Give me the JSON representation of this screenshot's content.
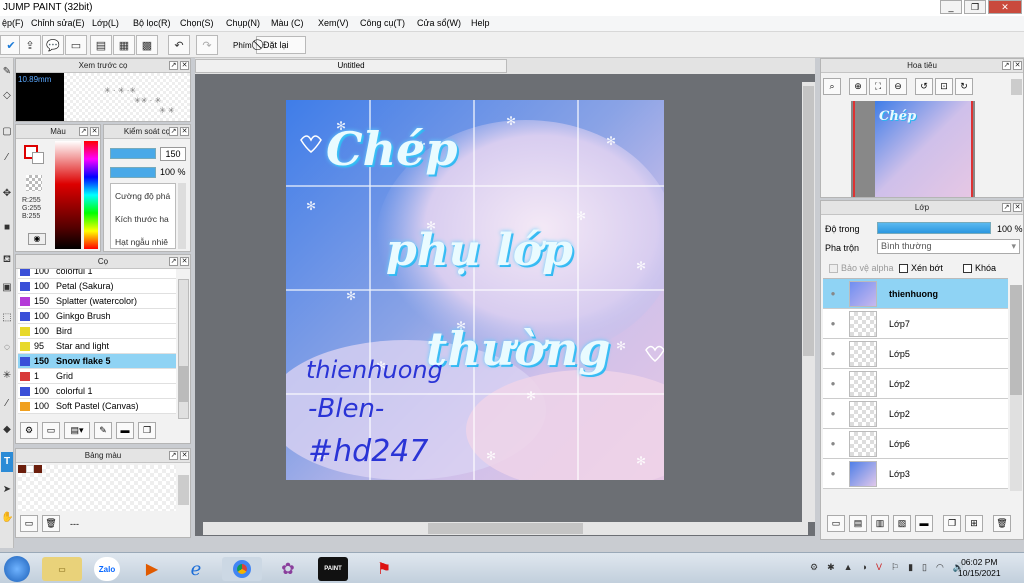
{
  "window": {
    "title": "JUMP PAINT (32bit)"
  },
  "menu": [
    "ệp(F)",
    "Chỉnh sửa(E)",
    "Lớp(L)",
    "Bộ lọc(R)",
    "Chọn(S)",
    "Chụp(N)",
    "Màu (C)",
    "Xem(V)",
    "Công cụ(T)",
    "Cửa sổ(W)",
    "Help"
  ],
  "toolbar": {
    "shortcut_label": "Phím",
    "reset_label": "Đặt lại"
  },
  "preview_panel": {
    "title": "Xem trước cọ",
    "size_text": "10.89mm"
  },
  "color_panel": {
    "title": "Màu",
    "r": "R:255",
    "g": "G:255",
    "b": "B:255"
  },
  "brush_control": {
    "title": "Kiểm soát cọ",
    "size_value": "150",
    "opacity_value": "100 %",
    "labels": [
      "Cường độ phá",
      "Kích thước ha",
      "Hạt ngẫu nhiê"
    ]
  },
  "brush_panel": {
    "title": "Cọ",
    "items": [
      {
        "size": "100",
        "name": "colorful 1",
        "color": "#3a4fd8"
      },
      {
        "size": "100",
        "name": "Petal (Sakura)",
        "color": "#3a4fd8"
      },
      {
        "size": "150",
        "name": "Splatter (watercolor)",
        "color": "#b43ad8"
      },
      {
        "size": "100",
        "name": "Ginkgo Brush",
        "color": "#3a4fd8"
      },
      {
        "size": "100",
        "name": "Bird",
        "color": "#e8d92a"
      },
      {
        "size": "95",
        "name": "Star and light",
        "color": "#e8d92a"
      },
      {
        "size": "150",
        "name": "Snow flake 5",
        "color": "#3a4fd8"
      },
      {
        "size": "1",
        "name": "Grid",
        "color": "#d83a3a"
      },
      {
        "size": "100",
        "name": "colorful 1",
        "color": "#3a4fd8"
      },
      {
        "size": "100",
        "name": "Soft Pastel (Canvas)",
        "color": "#f0a020"
      }
    ],
    "selected_index": 6
  },
  "palette_panel": {
    "title": "Bảng màu",
    "footer": "---"
  },
  "document": {
    "tab_title": "Untitled"
  },
  "artwork": {
    "line1": "Chép",
    "line2": "phụ lớp",
    "line3": "thường",
    "signature": [
      "thienhuong",
      "-Blen-",
      "#hd247"
    ]
  },
  "navigator": {
    "title": "Hoa tiêu"
  },
  "layer_panel": {
    "title": "Lớp",
    "opacity_label": "Độ trong",
    "opacity_value": "100 %",
    "blend_label": "Pha trộn",
    "blend_value": "Bình thường",
    "protect_alpha": "Bảo vệ alpha",
    "clipping": "Xén bớt",
    "lock": "Khóa",
    "layers": [
      "thienhuong",
      "Lớp7",
      "Lớp5",
      "Lớp2",
      "Lớp2",
      "Lớp6",
      "Lớp3"
    ],
    "selected_index": 0
  },
  "taskbar": {
    "time": "06:02 PM",
    "date": "10/15/2021",
    "apps": [
      "Zalo",
      "",
      "",
      "",
      "",
      "PAINT",
      ""
    ]
  }
}
